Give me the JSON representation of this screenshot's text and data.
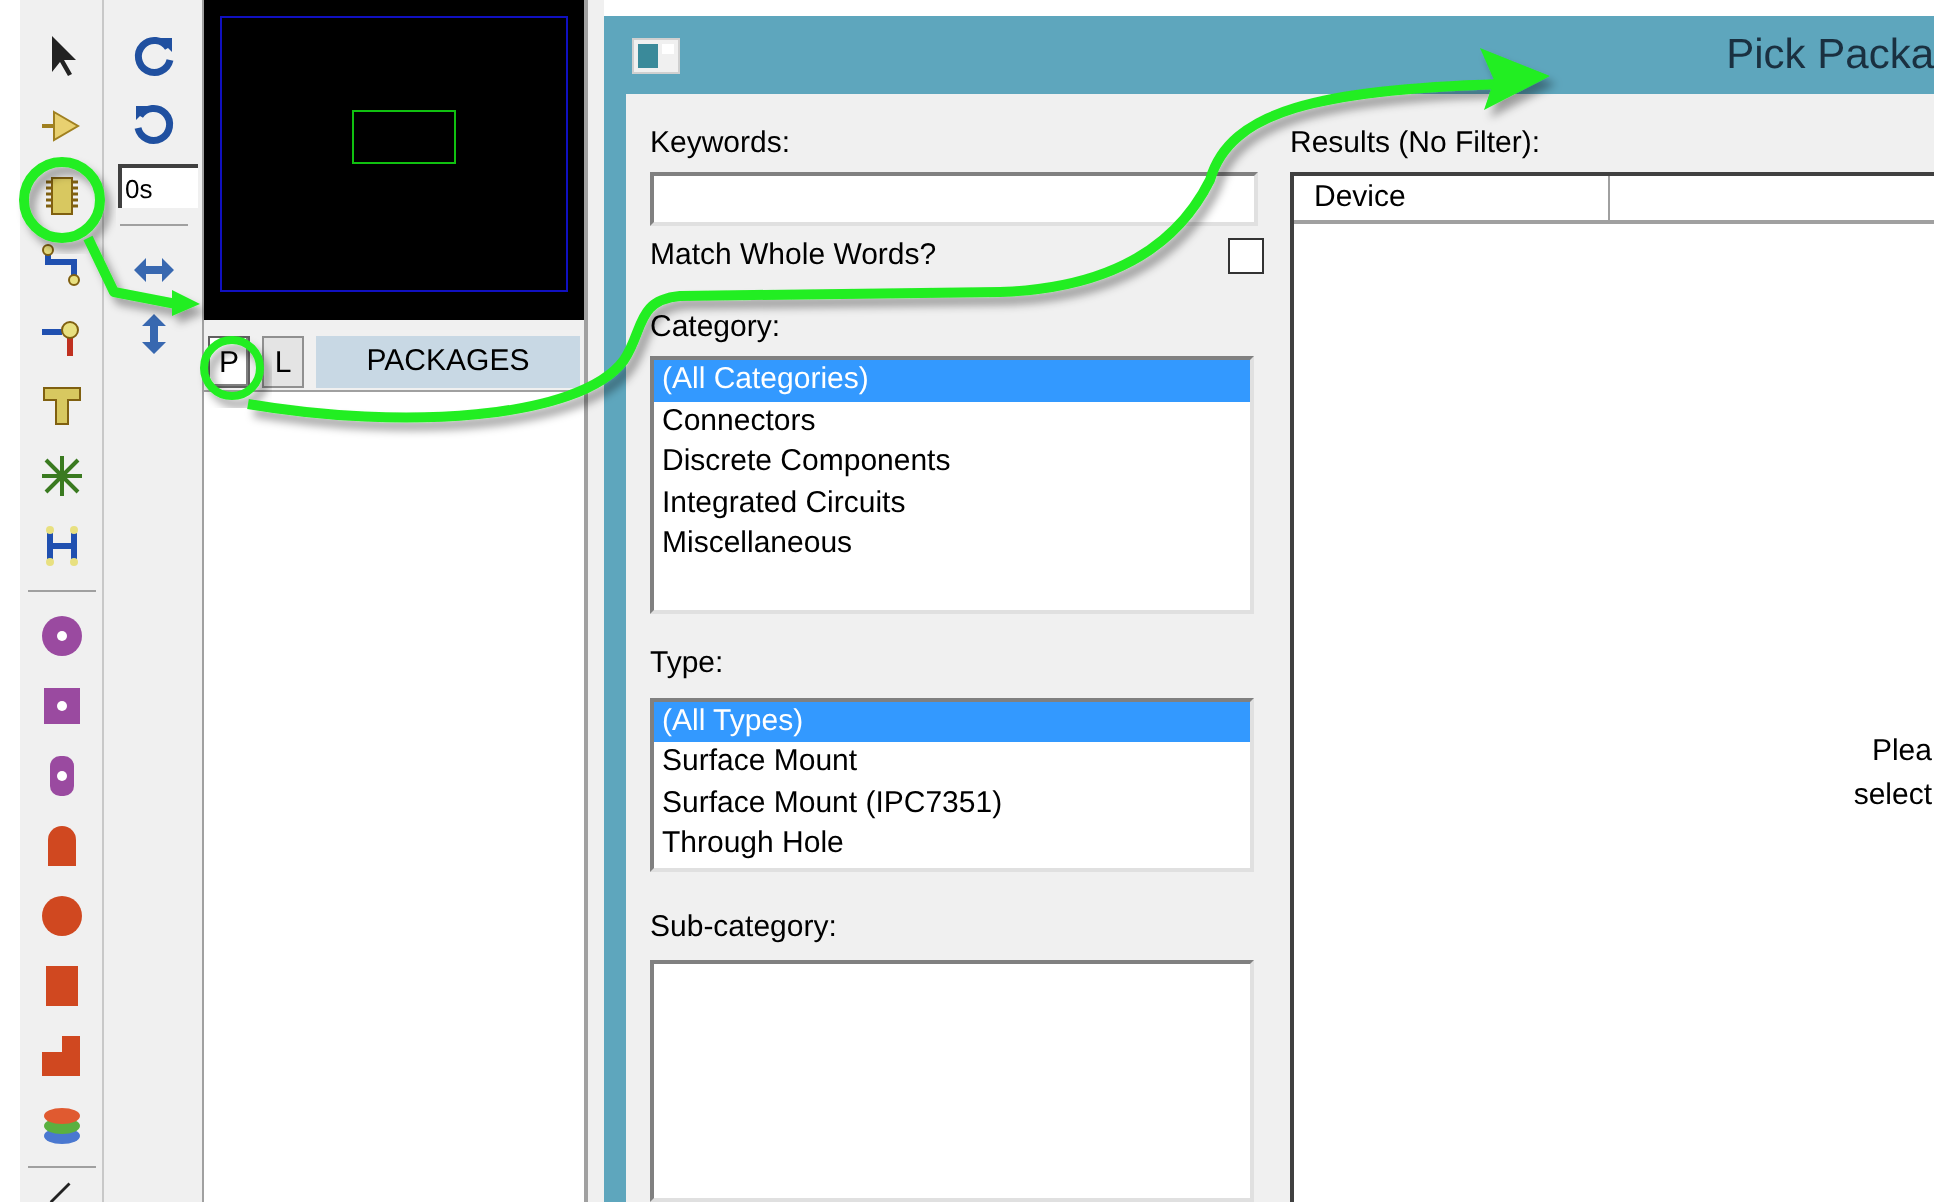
{
  "toolbar": {
    "time_value": "0s"
  },
  "panel": {
    "tabs": [
      {
        "label": "P",
        "selected": true
      },
      {
        "label": "L",
        "selected": false
      }
    ],
    "header": "PACKAGES"
  },
  "dialog": {
    "title": "Pick Packa",
    "keywords": {
      "label": "Keywords:"
    },
    "match_whole_words": {
      "label": "Match Whole Words?",
      "checked": false
    },
    "category": {
      "label": "Category:",
      "items": [
        {
          "label": "(All Categories)",
          "selected": true
        },
        {
          "label": "Connectors",
          "selected": false
        },
        {
          "label": "Discrete Components",
          "selected": false
        },
        {
          "label": "Integrated Circuits",
          "selected": false
        },
        {
          "label": "Miscellaneous",
          "selected": false
        }
      ]
    },
    "type": {
      "label": "Type:",
      "items": [
        {
          "label": "(All Types)",
          "selected": true
        },
        {
          "label": "Surface Mount",
          "selected": false
        },
        {
          "label": "Surface Mount (IPC7351)",
          "selected": false
        },
        {
          "label": "Through Hole",
          "selected": false
        }
      ]
    },
    "sub_category": {
      "label": "Sub-category:"
    },
    "results": {
      "label": "Results (No Filter):",
      "columns": [
        "Device"
      ],
      "message": [
        "Plea",
        "select"
      ]
    }
  }
}
